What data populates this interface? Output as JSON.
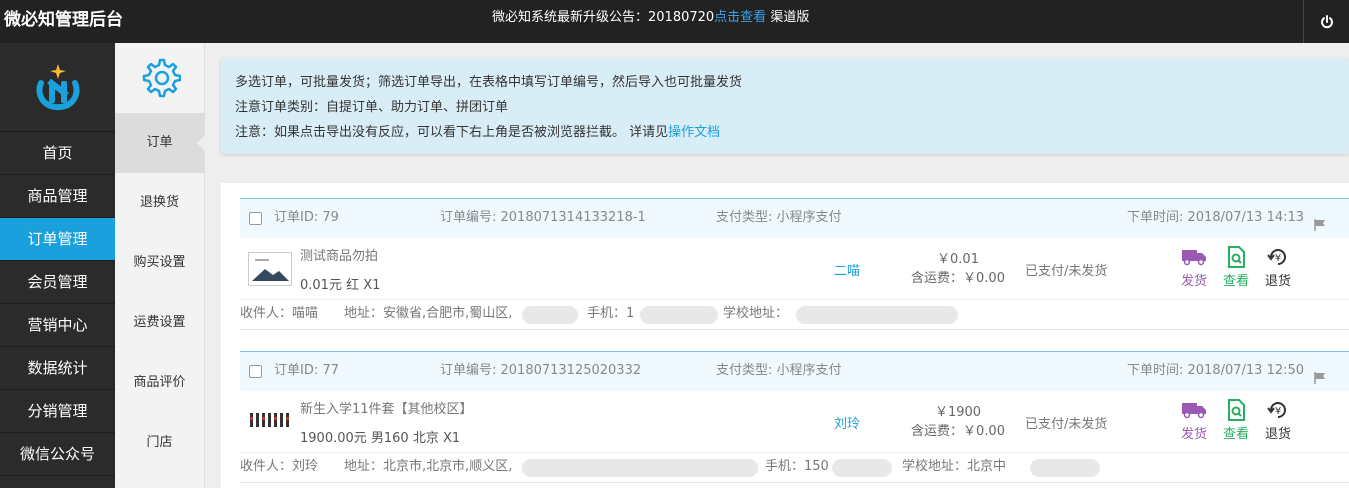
{
  "header": {
    "brand": "微必知管理后台",
    "notice_text": "微必知系统最新升级公告：20180720",
    "notice_link": "点击查看",
    "notice_suffix": " 渠道版"
  },
  "main_nav": [
    {
      "label": "首页",
      "active": false
    },
    {
      "label": "商品管理",
      "active": false
    },
    {
      "label": "订单管理",
      "active": true
    },
    {
      "label": "会员管理",
      "active": false
    },
    {
      "label": "营销中心",
      "active": false
    },
    {
      "label": "数据统计",
      "active": false
    },
    {
      "label": "分销管理",
      "active": false
    },
    {
      "label": "微信公众号",
      "active": false
    }
  ],
  "sub_nav": [
    {
      "label": "订单",
      "active": true
    },
    {
      "label": "退换货",
      "active": false
    },
    {
      "label": "购买设置",
      "active": false
    },
    {
      "label": "运费设置",
      "active": false
    },
    {
      "label": "商品评价",
      "active": false
    },
    {
      "label": "门店",
      "active": false
    }
  ],
  "tips": {
    "line1": "多选订单，可批量发货；筛选订单导出，在表格中填写订单编号，然后导入也可批量发货",
    "line2": "注意订单类别：自提订单、助力订单、拼团订单",
    "line3": "注意：如果点击导出没有反应，可以看下右上角是否被浏览器拦截。 详请见",
    "line3_link": "操作文档"
  },
  "orders": [
    {
      "id": "订单ID:  79",
      "number": "订单编号:  2018071314133218-1",
      "pay_type": "支付类型:  小程序支付",
      "time": "下单时间:  2018/07/13 14:13",
      "product_name": "测试商品勿拍",
      "product_spec": "0.01元   红    X1",
      "buyer": "二喵",
      "price": "￥0.01",
      "shipping": "含运费：￥0.00",
      "status": "已支付/未发货",
      "receiver": "收件人：喵喵",
      "address": "地址：安徽省,合肥市,蜀山区,",
      "phone": "手机：1",
      "school": "学校地址："
    },
    {
      "id": "订单ID:  77",
      "number": "订单编号:  20180713125020332",
      "pay_type": "支付类型:  小程序支付",
      "time": "下单时间:  2018/07/13 12:50",
      "product_name": "新生入学11件套【其他校区】",
      "product_spec": "1900.00元   男160 北京    X1",
      "buyer": "刘玲",
      "price": "￥1900",
      "shipping": "含运费：￥0.00",
      "status": "已支付/未发货",
      "receiver": "收件人：刘玲",
      "address": "地址：北京市,北京市,顺义区,",
      "phone": "手机：150",
      "school": "学校地址：北京中"
    }
  ],
  "actions": {
    "ship": "发货",
    "view": "查看",
    "refund": "退货"
  },
  "colors": {
    "topbar": "#222222",
    "accent": "#1aa0dc",
    "ship": "#9b59b6",
    "view": "#27ae60"
  }
}
